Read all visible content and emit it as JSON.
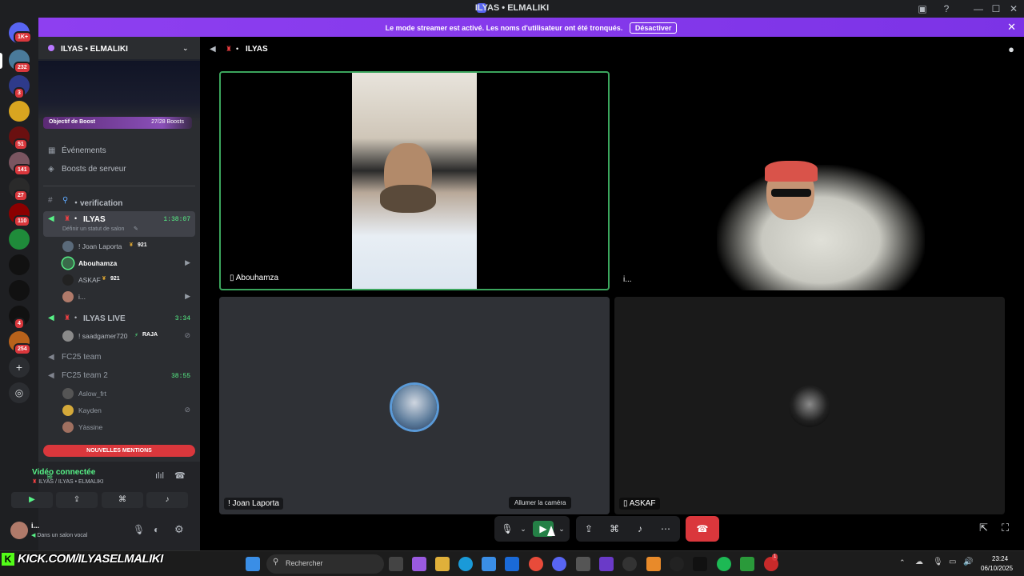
{
  "window": {
    "title": "ILYAS • ELMALIKI",
    "minimize": "—",
    "maximize": "☐",
    "close": "✕"
  },
  "banner": {
    "message": "Le mode streamer est activé. Les noms d'utilisateur ont été tronqués.",
    "button": "Désactiver"
  },
  "rail": {
    "badges": [
      "1K+",
      "232",
      "3",
      "51",
      "141",
      "27",
      "110",
      "4",
      "254"
    ],
    "icons": [
      "discord-home-icon",
      "add-server-icon",
      "discover-icon"
    ]
  },
  "server": {
    "name": "ILYAS • ELMALIKI",
    "boost_label": "Objectif de Boost",
    "boost_count": "27/28 Boosts",
    "menu": [
      "Événements",
      "Boosts de serveur"
    ]
  },
  "channels": {
    "verification": "・verification",
    "voice1": {
      "name": "ILYAS",
      "timer": "1:38:07",
      "status_hint": "Définir un statut de salon",
      "users": [
        {
          "name": "! Joan Laporta",
          "tag": "921"
        },
        {
          "name": "Abouhamza",
          "tag": ""
        },
        {
          "name": "ASKAF",
          "tag": "921"
        },
        {
          "name": "i...",
          "tag": ""
        }
      ]
    },
    "voice2": {
      "name": "ILYAS LIVE",
      "timer": "3:34",
      "users": [
        {
          "name": "! saadgamer720",
          "tag": "RAJA"
        }
      ]
    },
    "voice3": {
      "name": "FC25 team"
    },
    "voice4": {
      "name": "FC25 team 2",
      "timer": "38:55",
      "users": [
        {
          "name": "Aslow_frt"
        },
        {
          "name": "Kayden"
        },
        {
          "name": "Yàssine"
        }
      ]
    },
    "mentions_button": "NOUVELLES MENTIONS"
  },
  "voice_status": {
    "title": "Vidéo connectée",
    "subtitle": "ILYAS / ILYAS • ELMALIKI"
  },
  "user_area": {
    "name": "i...",
    "status": "Dans un salon vocal"
  },
  "stage": {
    "header_title": "ILYAS",
    "tiles": [
      {
        "name": "Abouhamza"
      },
      {
        "name": "i..."
      },
      {
        "name": "! Joan Laporta"
      },
      {
        "name": "ASKAF"
      }
    ],
    "tooltip": "Allumer la caméra"
  },
  "taskbar": {
    "search": "Rechercher",
    "time": "23:24",
    "date": "06/10/2025",
    "overlay": "KICK.COM/ILYASELMALIKI",
    "notif_badge": "1"
  },
  "colors": {
    "accent": "#5865f2",
    "banner": "#8e3ff0",
    "green": "#57f287",
    "red": "#da373c"
  }
}
